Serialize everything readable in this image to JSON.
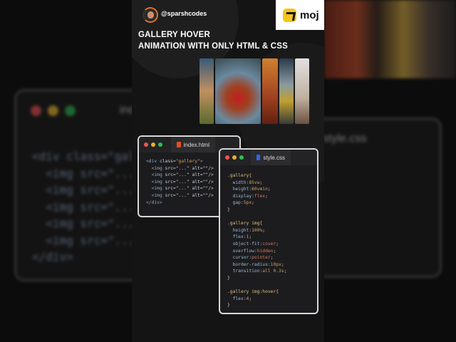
{
  "header": {
    "handle": "@sparshcodes",
    "brand": "moj"
  },
  "title": [
    "GALLERY HOVER",
    "ANIMATION WITH ONLY HTML & CSS"
  ],
  "gallery_colors": [
    "#6a6a50",
    "#5a7a8a",
    "#c06030",
    "#8a8a80",
    "#c8c0b0"
  ],
  "html_window": {
    "tab": "index.html",
    "icon_color": "#e44d26",
    "lines": [
      [
        [
          "<div ",
          "#8fa8c8"
        ],
        [
          "class",
          "#c8d0e0"
        ],
        [
          "=",
          "#ccc"
        ],
        [
          "\"gallery\"",
          "#d6a060"
        ],
        [
          ">",
          "#8fa8c8"
        ]
      ],
      [
        [
          "  <img ",
          "#8fa8c8"
        ],
        [
          "src",
          "#c8d0e0"
        ],
        [
          "=\"...\" ",
          "#ccc"
        ],
        [
          "alt",
          "#c8d0e0"
        ],
        [
          "=\"\"/>",
          "#ccc"
        ]
      ],
      [
        [
          "  <img ",
          "#8fa8c8"
        ],
        [
          "src",
          "#c8d0e0"
        ],
        [
          "=\"...\" ",
          "#ccc"
        ],
        [
          "alt",
          "#c8d0e0"
        ],
        [
          "=\"\"/>",
          "#ccc"
        ]
      ],
      [
        [
          "  <img ",
          "#8fa8c8"
        ],
        [
          "src",
          "#c8d0e0"
        ],
        [
          "=\"...\" ",
          "#ccc"
        ],
        [
          "alt",
          "#c8d0e0"
        ],
        [
          "=\"\"/>",
          "#ccc"
        ]
      ],
      [
        [
          "  <img ",
          "#8fa8c8"
        ],
        [
          "src",
          "#c8d0e0"
        ],
        [
          "=\"...\" ",
          "#ccc"
        ],
        [
          "alt",
          "#c8d0e0"
        ],
        [
          "=\"\"/>",
          "#ccc"
        ]
      ],
      [
        [
          "  <img ",
          "#8fa8c8"
        ],
        [
          "src",
          "#c8d0e0"
        ],
        [
          "=\"...\" ",
          "#ccc"
        ],
        [
          "alt",
          "#c8d0e0"
        ],
        [
          "=\"\"/>",
          "#ccc"
        ]
      ],
      [
        [
          "</div>",
          "#8fa8c8"
        ]
      ]
    ]
  },
  "css_window": {
    "tab": "style.css",
    "icon_color": "#2965f1",
    "lines": [
      [
        [
          ".gallery{",
          "#e0c080"
        ]
      ],
      [
        [
          "  width:",
          "#9ab8d8"
        ],
        [
          "85vw",
          "#d6a060"
        ],
        [
          ";",
          "#ccc"
        ]
      ],
      [
        [
          "  height:",
          "#9ab8d8"
        ],
        [
          "60vmin",
          "#d6a060"
        ],
        [
          ";",
          "#ccc"
        ]
      ],
      [
        [
          "  display:",
          "#9ab8d8"
        ],
        [
          "flex",
          "#d67a60"
        ],
        [
          ";",
          "#ccc"
        ]
      ],
      [
        [
          "  gap:",
          "#9ab8d8"
        ],
        [
          "5px",
          "#d6a060"
        ],
        [
          ";",
          "#ccc"
        ]
      ],
      [
        [
          "}",
          "#ccc"
        ]
      ],
      [
        [
          "",
          "#ccc"
        ]
      ],
      [
        [
          ".gallery img{",
          "#e0c080"
        ]
      ],
      [
        [
          "  height:",
          "#9ab8d8"
        ],
        [
          "100%",
          "#d6a060"
        ],
        [
          ";",
          "#ccc"
        ]
      ],
      [
        [
          "  flex:",
          "#9ab8d8"
        ],
        [
          "1",
          "#d6a060"
        ],
        [
          ";",
          "#ccc"
        ]
      ],
      [
        [
          "  object-fit:",
          "#9ab8d8"
        ],
        [
          "cover",
          "#d67a60"
        ],
        [
          ";",
          "#ccc"
        ]
      ],
      [
        [
          "  overflow:",
          "#9ab8d8"
        ],
        [
          "hidden",
          "#d67a60"
        ],
        [
          ";",
          "#ccc"
        ]
      ],
      [
        [
          "  cursor:",
          "#9ab8d8"
        ],
        [
          "pointer",
          "#d67a60"
        ],
        [
          ";",
          "#ccc"
        ]
      ],
      [
        [
          "  border-radius:",
          "#9ab8d8"
        ],
        [
          "10px",
          "#d6a060"
        ],
        [
          ";",
          "#ccc"
        ]
      ],
      [
        [
          "  transition:",
          "#9ab8d8"
        ],
        [
          "all 0.3s",
          "#d6a060"
        ],
        [
          ";",
          "#ccc"
        ]
      ],
      [
        [
          "}",
          "#ccc"
        ]
      ],
      [
        [
          "",
          "#ccc"
        ]
      ],
      [
        [
          ".gallery img:hover{",
          "#e0c080"
        ]
      ],
      [
        [
          "  flex:",
          "#9ab8d8"
        ],
        [
          "4",
          "#d6a060"
        ],
        [
          ";",
          "#ccc"
        ]
      ],
      [
        [
          "}",
          "#ccc"
        ]
      ]
    ]
  },
  "background": {
    "left_tab": "index.html",
    "right_tab": "style.css"
  }
}
